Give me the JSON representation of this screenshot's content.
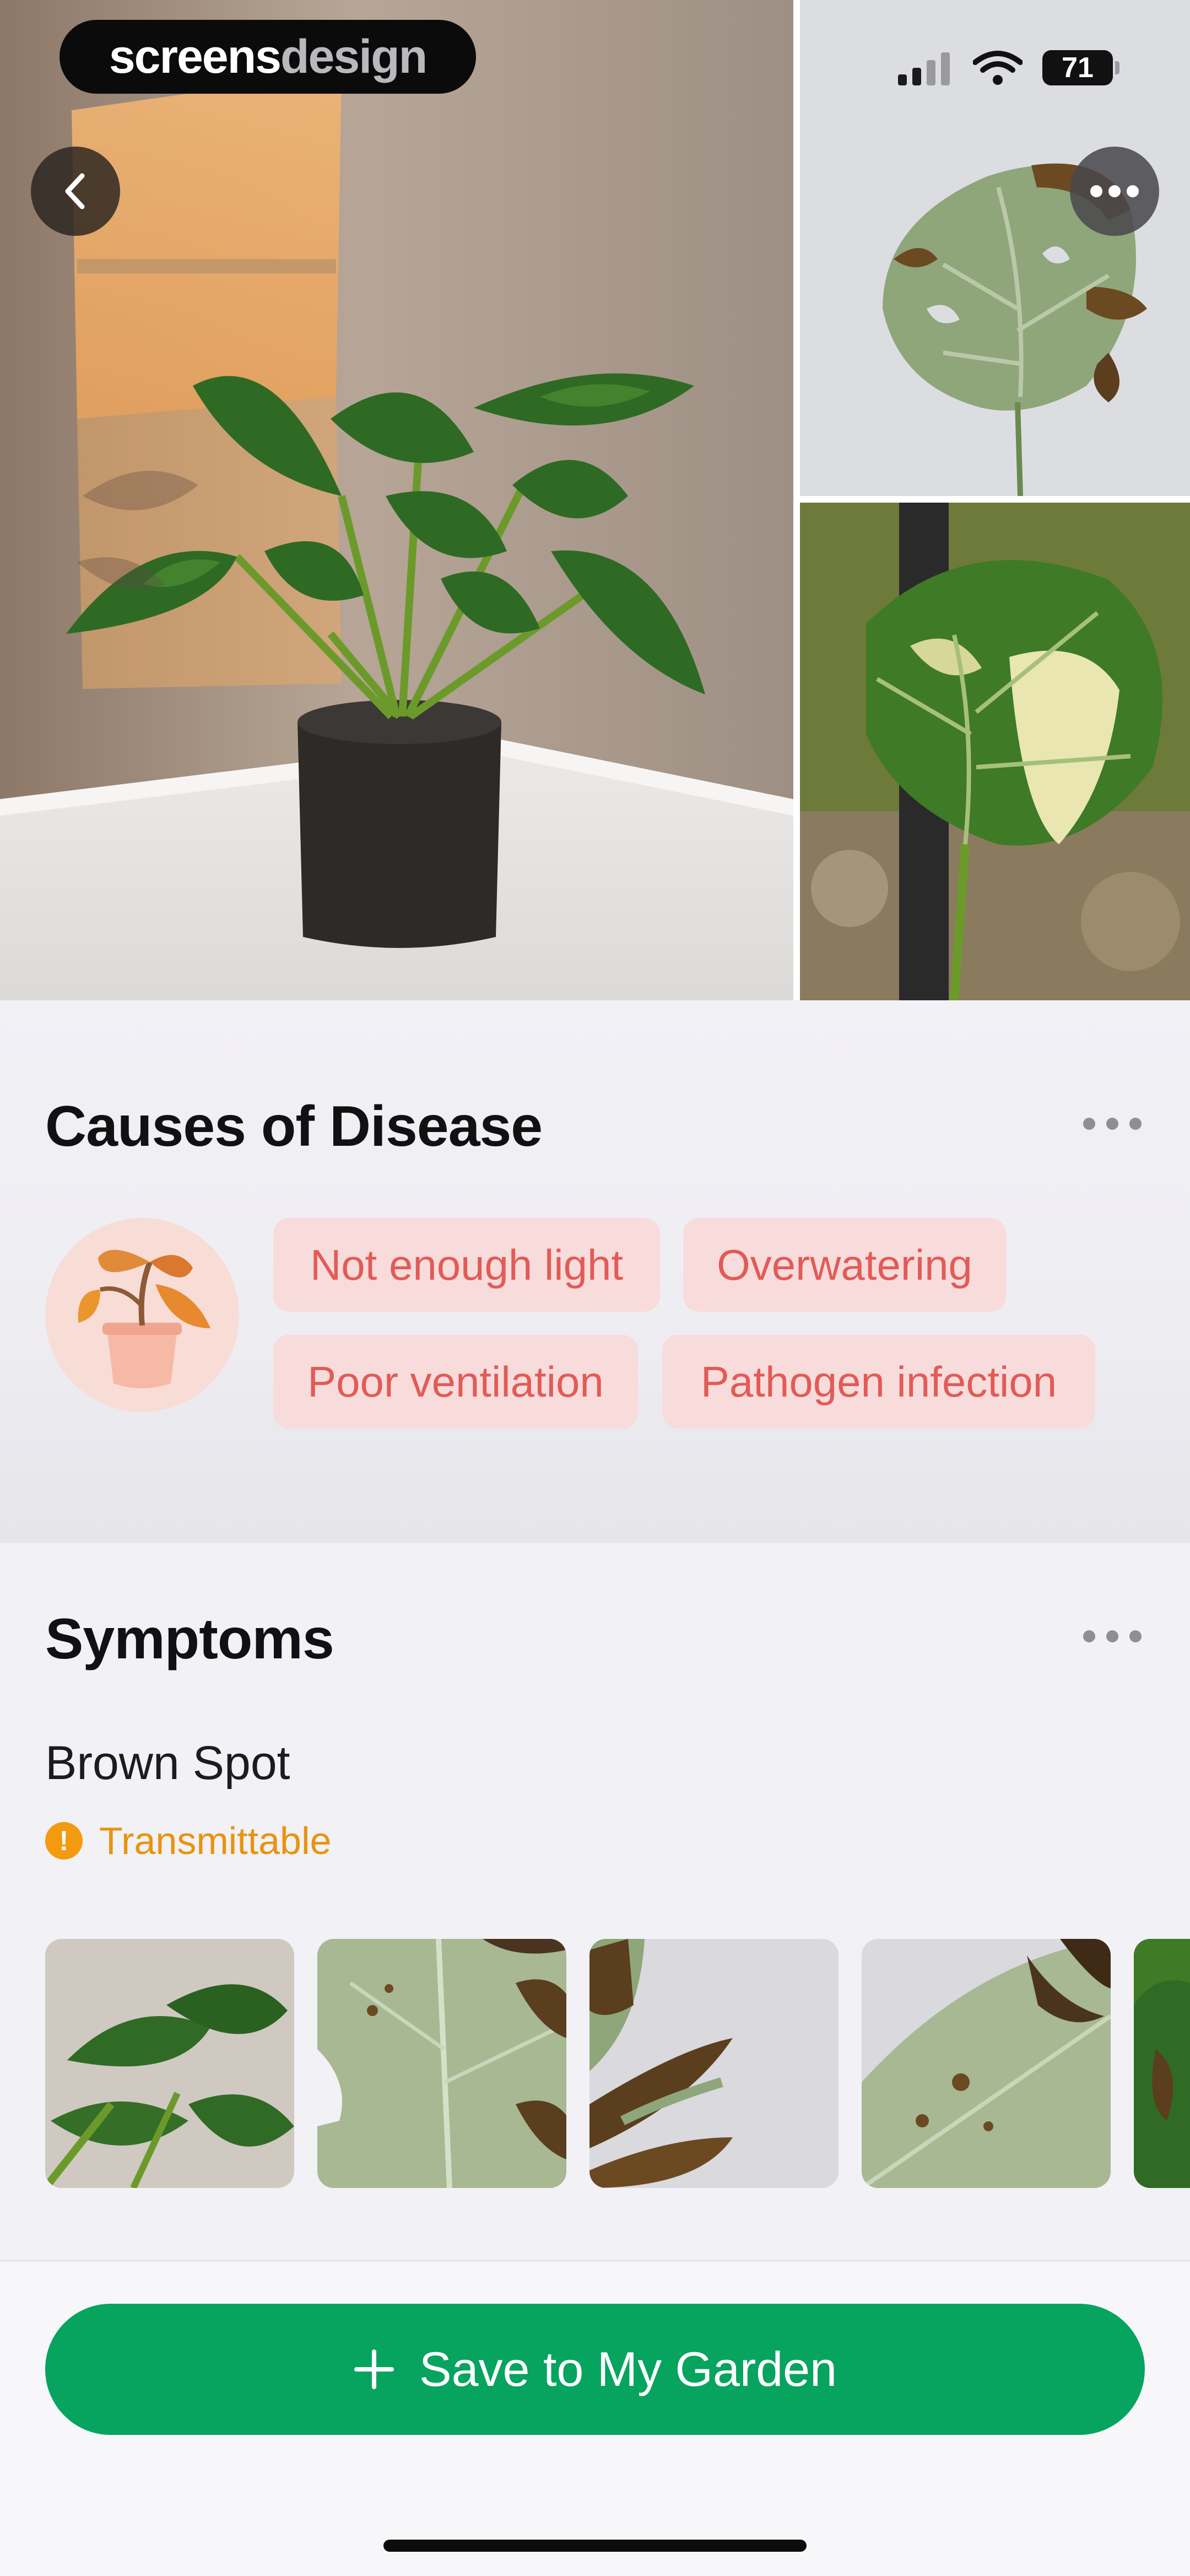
{
  "brand": {
    "part1": "screens",
    "part2": "design"
  },
  "status_bar": {
    "battery": "71"
  },
  "causes": {
    "title": "Causes of Disease",
    "tags": [
      "Not enough light",
      "Overwatering",
      "Poor ventilation",
      "Pathogen infection"
    ]
  },
  "symptoms": {
    "title": "Symptoms",
    "name": "Brown Spot",
    "badge": "Transmittable"
  },
  "actions": {
    "save_label": "Save to My Garden"
  },
  "icons": {
    "back": "chevron-left-icon",
    "more": "ellipsis-icon",
    "signal": "cellular-signal-icon",
    "wifi": "wifi-icon",
    "battery": "battery-icon",
    "plant": "wilted-plant-icon",
    "warning": "exclamation-circle-icon",
    "plus": "plus-icon"
  },
  "colors": {
    "accent_green": "#06a45f",
    "tag_background": "#f8dcdc",
    "tag_text": "#e25b56",
    "warning": "#f39a0f"
  }
}
